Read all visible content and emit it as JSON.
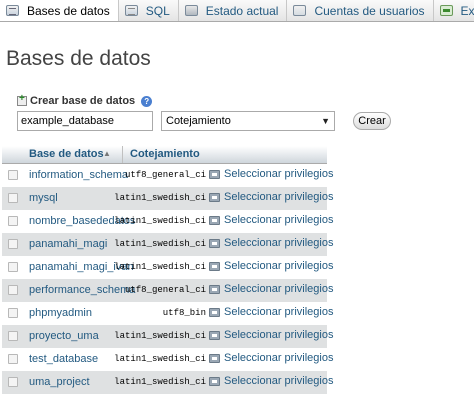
{
  "tabs": [
    {
      "label": "Bases de datos",
      "icon": "database-icon",
      "active": true
    },
    {
      "label": "SQL",
      "icon": "sql-icon",
      "active": false
    },
    {
      "label": "Estado actual",
      "icon": "status-icon",
      "active": false
    },
    {
      "label": "Cuentas de usuarios",
      "icon": "users-icon",
      "active": false
    },
    {
      "label": "Exportar",
      "icon": "export-icon",
      "active": false
    }
  ],
  "page": {
    "title": "Bases de datos"
  },
  "create": {
    "label": "Crear base de datos",
    "help": "?",
    "input_value": "example_database",
    "collation_selected": "Cotejamiento",
    "button_label": "Crear"
  },
  "table": {
    "headers": {
      "name": "Base de datos",
      "sort_indicator": "▲",
      "collation": "Cotejamiento"
    },
    "privileges_label": "Seleccionar privilegios",
    "rows": [
      {
        "name": "information_schema",
        "collation": "utf8_general_ci"
      },
      {
        "name": "mysql",
        "collation": "latin1_swedish_ci"
      },
      {
        "name": "nombre_basededatos",
        "collation": "latin1_swedish_ci"
      },
      {
        "name": "panamahi_magi",
        "collation": "latin1_swedish_ci"
      },
      {
        "name": "panamahi_magi_ivan",
        "collation": "latin1_swedish_ci"
      },
      {
        "name": "performance_schema",
        "collation": "utf8_general_ci"
      },
      {
        "name": "phpmyadmin",
        "collation": "utf8_bin"
      },
      {
        "name": "proyecto_uma",
        "collation": "latin1_swedish_ci"
      },
      {
        "name": "test_database",
        "collation": "latin1_swedish_ci"
      },
      {
        "name": "uma_project",
        "collation": "latin1_swedish_ci"
      }
    ]
  },
  "colors": {
    "link": "#235a81",
    "row_alt": "#dfe1e2"
  }
}
